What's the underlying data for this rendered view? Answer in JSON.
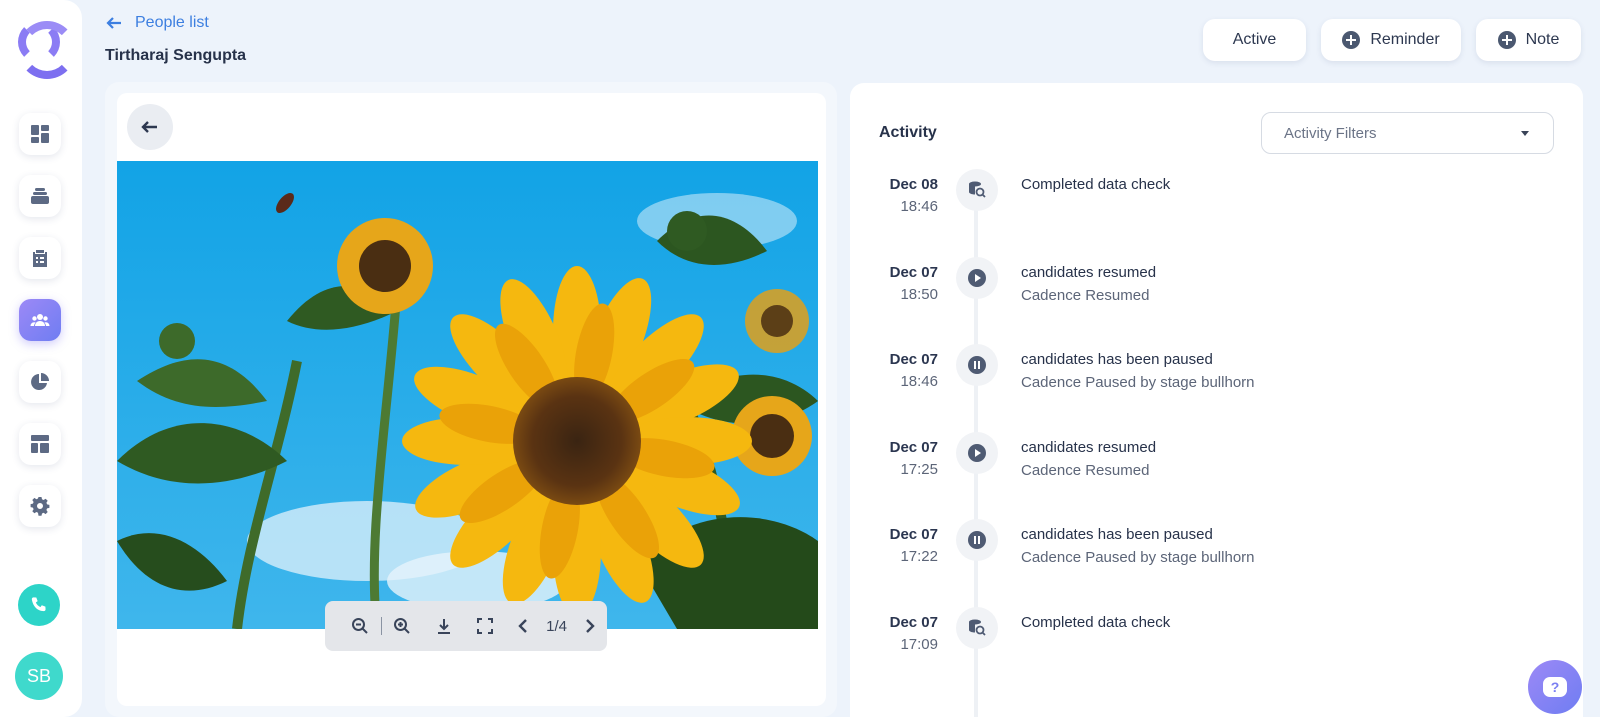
{
  "header": {
    "back_label": "People list",
    "person_name": "Tirtharaj Sengupta",
    "status_button": "Active",
    "reminder_button": "Reminder",
    "note_button": "Note"
  },
  "sidebar": {
    "items": [
      {
        "icon": "dashboard-icon"
      },
      {
        "icon": "stack-icon"
      },
      {
        "icon": "clipboard-icon"
      },
      {
        "icon": "people-icon",
        "active": true
      },
      {
        "icon": "pie-chart-icon"
      },
      {
        "icon": "layout-icon"
      },
      {
        "icon": "gear-icon"
      }
    ],
    "avatar_initials": "SB"
  },
  "viewer": {
    "pager": "1/4"
  },
  "activity": {
    "title": "Activity",
    "filter_placeholder": "Activity Filters",
    "entries": [
      {
        "date": "Dec 08",
        "time": "18:46",
        "icon": "data-check-icon",
        "title": "Completed data check",
        "subtitle": ""
      },
      {
        "date": "Dec 07",
        "time": "18:50",
        "icon": "play-icon",
        "title": "candidates resumed",
        "subtitle": "Cadence Resumed"
      },
      {
        "date": "Dec 07",
        "time": "18:46",
        "icon": "pause-icon",
        "title": "candidates has been paused",
        "subtitle": "Cadence Paused by stage bullhorn"
      },
      {
        "date": "Dec 07",
        "time": "17:25",
        "icon": "play-icon",
        "title": "candidates resumed",
        "subtitle": "Cadence Resumed"
      },
      {
        "date": "Dec 07",
        "time": "17:22",
        "icon": "pause-icon",
        "title": "candidates has been paused",
        "subtitle": "Cadence Paused by stage bullhorn"
      },
      {
        "date": "Dec 07",
        "time": "17:09",
        "icon": "data-check-icon",
        "title": "Completed data check",
        "subtitle": ""
      }
    ]
  },
  "colors": {
    "accent": "#8b7cf4",
    "link": "#3d7fe0",
    "phone": "#2dd4c8"
  }
}
